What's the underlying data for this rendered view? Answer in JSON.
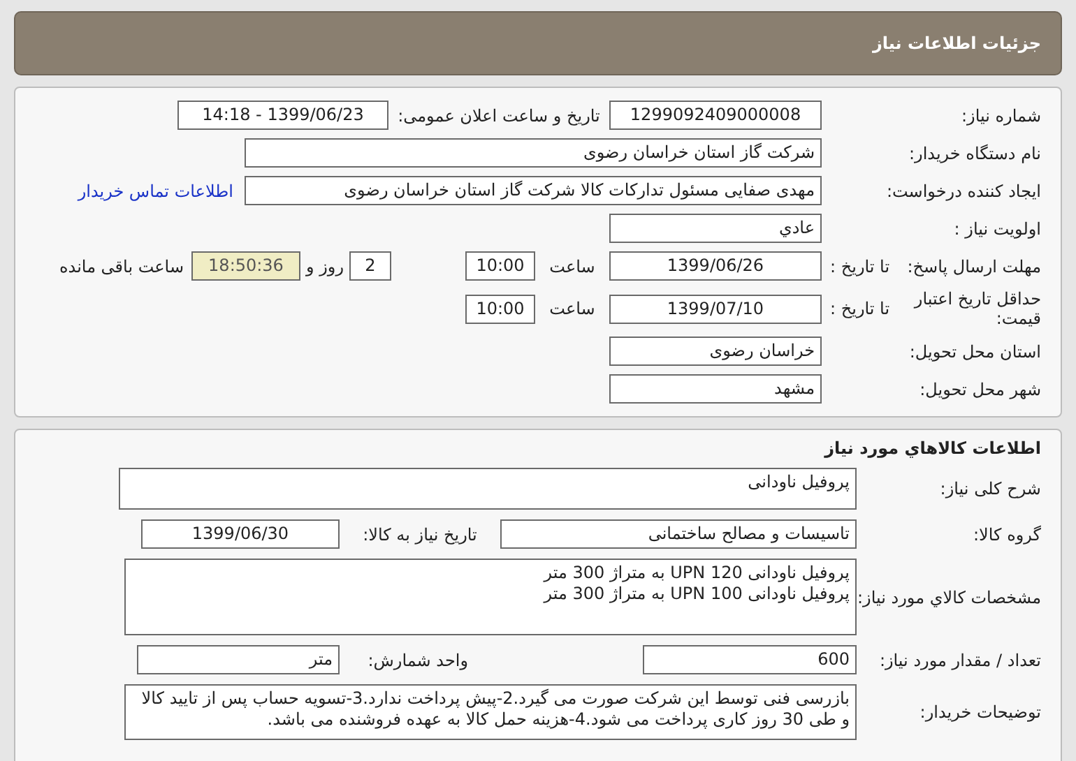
{
  "title": "جزئیات اطلاعات نیاز",
  "need_number": {
    "label": "شماره نیاز:",
    "value": "1299092409000008"
  },
  "announce": {
    "label": "تاریخ و ساعت اعلان عمومی:",
    "value": "1399/06/23 - 14:18"
  },
  "buyer": {
    "label": "نام دستگاه خریدار:",
    "value": "شرکت گاز استان خراسان رضوی"
  },
  "creator": {
    "label": "ایجاد کننده درخواست:",
    "value": "مهدی صفایی مسئول تدارکات کالا شرکت گاز استان خراسان رضوی",
    "link": "اطلاعات تماس خریدار"
  },
  "priority": {
    "label": "اولویت نیاز :",
    "value": "عادي"
  },
  "deadline": {
    "label": "مهلت ارسال پاسخ:",
    "date_label": "تا تاریخ :",
    "date": "1399/06/26",
    "time_label": "ساعت",
    "time": "10:00",
    "days": "2",
    "days_label": "روز و",
    "remaining": "18:50:36",
    "remaining_label": "ساعت باقی مانده"
  },
  "validity": {
    "label": "حداقل تاریخ اعتبار قیمت:",
    "date_label": "تا تاریخ :",
    "date": "1399/07/10",
    "time_label": "ساعت",
    "time": "10:00"
  },
  "province": {
    "label": "استان محل تحویل:",
    "value": "خراسان رضوی"
  },
  "city": {
    "label": "شهر محل تحویل:",
    "value": "مشهد"
  },
  "goods": {
    "title": "اطلاعات کالاهاي مورد نياز",
    "description": {
      "label": "شرح کلی نیاز:",
      "value": "پروفیل ناودانی"
    },
    "group": {
      "label": "گروه کالا:",
      "value": "تاسیسات و مصالح ساختمانی"
    },
    "need_date": {
      "label": "تاریخ نیاز به کالا:",
      "value": "1399/06/30"
    },
    "specs": {
      "label": "مشخصات کالاي مورد نياز:",
      "lines": [
        "پروفیل ناودانی  UPN 120  به متراژ 300 متر",
        "پروفیل ناودانی  UPN 100  به متراژ 300 متر"
      ]
    },
    "quantity": {
      "label": "تعداد / مقدار مورد نیاز:",
      "value": "600"
    },
    "unit": {
      "label": "واحد شمارش:",
      "value": "متر"
    },
    "notes": {
      "label": "توضیحات خریدار:",
      "value": "بازرسی فنی توسط این شرکت صورت می گیرد.2-پیش پرداخت ندارد.3-تسویه حساب پس از تایید کالا و طی 30 روز کاری پرداخت می شود.4-هزینه حمل کالا به عهده فروشنده می باشد."
    }
  }
}
